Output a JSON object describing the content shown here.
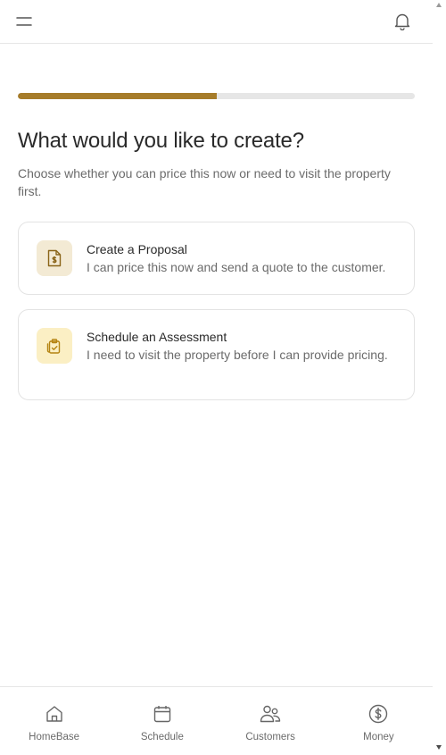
{
  "header": {
    "menu_icon": "hamburger-menu-icon",
    "notifications_icon": "bell-icon"
  },
  "progress": {
    "value": 0.5,
    "color": "#a67c2a"
  },
  "main": {
    "title": "What would you like to create?",
    "subtitle": "Choose whether you can price this now or need to visit the property first.",
    "options": [
      {
        "icon": "document-dollar-icon",
        "title": "Create a Proposal",
        "description": "I can price this now and send a quote to the customer."
      },
      {
        "icon": "clipboard-check-icon",
        "title": "Schedule an Assessment",
        "description": "I need to visit the property before I can provide pricing."
      }
    ]
  },
  "bottom_nav": {
    "items": [
      {
        "icon": "home-icon",
        "label": "HomeBase"
      },
      {
        "icon": "calendar-icon",
        "label": "Schedule"
      },
      {
        "icon": "users-icon",
        "label": "Customers"
      },
      {
        "icon": "dollar-circle-icon",
        "label": "Money"
      }
    ]
  },
  "colors": {
    "accent": "#a67c2a",
    "proposal_icon_bg": "#f3ead4",
    "assessment_icon_bg": "#fbefc4"
  }
}
